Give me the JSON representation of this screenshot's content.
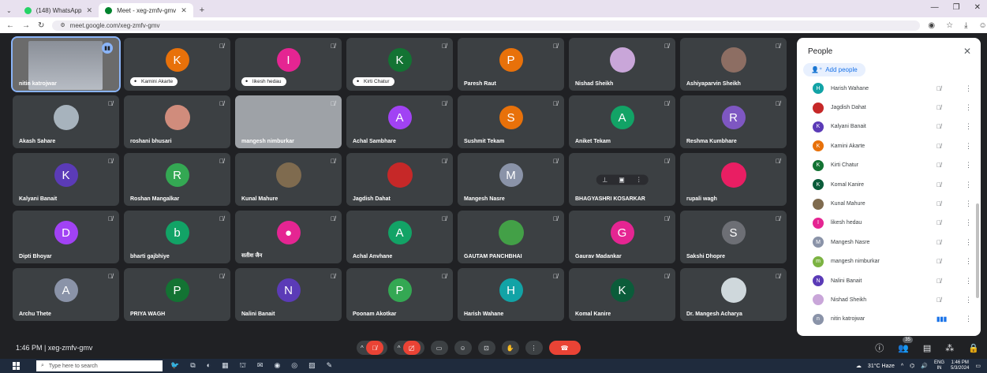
{
  "browser": {
    "tabs": [
      {
        "label": "(148) WhatsApp",
        "active": false,
        "favicon_color": "#25D366"
      },
      {
        "label": "Meet - xeg-zmfv-gmv",
        "active": true,
        "favicon_color": "#00832d"
      }
    ],
    "url": "meet.google.com/xeg-zmfv-gmv"
  },
  "tiles": [
    {
      "name": "nitin katrojwar",
      "type": "video",
      "active": true,
      "speaking": true
    },
    {
      "name": "Kamini Akarte",
      "type": "avatar",
      "letter": "K",
      "color": "#e8710a",
      "chip": true
    },
    {
      "name": "likesh hedau",
      "type": "avatar",
      "letter": "I",
      "color": "#e52592",
      "chip": true
    },
    {
      "name": "Kirti Chatur",
      "type": "avatar",
      "letter": "K",
      "color": "#137333",
      "chip": true
    },
    {
      "name": "Paresh Raut",
      "type": "avatar",
      "letter": "P",
      "color": "#e8710a"
    },
    {
      "name": "Nishad Sheikh",
      "type": "photo",
      "color": "#c9a6d9"
    },
    {
      "name": "Ashiyaparvin Sheikh",
      "type": "photo",
      "color": "#8d6e63"
    },
    {
      "name": "Akash Sahare",
      "type": "photo",
      "color": "#a7b3bd"
    },
    {
      "name": "roshani bhusari",
      "type": "photo",
      "color": "#d08c7c"
    },
    {
      "name": "mangesh nimburkar",
      "type": "greyvideo"
    },
    {
      "name": "Achal Sambhare",
      "type": "avatar",
      "letter": "A",
      "color": "#a142f4"
    },
    {
      "name": "Sushmit Tekam",
      "type": "avatar",
      "letter": "S",
      "color": "#e8710a"
    },
    {
      "name": "Aniket Tekam",
      "type": "avatar",
      "letter": "A",
      "color": "#12a366"
    },
    {
      "name": "Reshma Kumbhare",
      "type": "avatar",
      "letter": "R",
      "color": "#7e57c2"
    },
    {
      "name": "Kalyani Banait",
      "type": "avatar",
      "letter": "K",
      "color": "#5b3bb7"
    },
    {
      "name": "Roshan Mangalkar",
      "type": "avatar",
      "letter": "R",
      "color": "#34a853"
    },
    {
      "name": "Kunal Mahure",
      "type": "photo",
      "color": "#7f6b4f"
    },
    {
      "name": "Jagdish Dahat",
      "type": "photo",
      "color": "#c62828"
    },
    {
      "name": "Mangesh Nasre",
      "type": "avatar",
      "letter": "M",
      "color": "#8a93a8"
    },
    {
      "name": "BHAGYASHRI KOSARKAR",
      "type": "hover"
    },
    {
      "name": "rupali wagh",
      "type": "photo",
      "color": "#e91e63"
    },
    {
      "name": "Dipti Bhoyar",
      "type": "avatar",
      "letter": "D",
      "color": "#a142f4"
    },
    {
      "name": "bharti gajbhiye",
      "type": "avatar",
      "letter": "b",
      "color": "#12a366"
    },
    {
      "name": "सतीश जैन",
      "type": "avatar",
      "letter": "●",
      "color": "#e52592"
    },
    {
      "name": "Achal Anvhane",
      "type": "avatar",
      "letter": "A",
      "color": "#12a366"
    },
    {
      "name": "GAUTAM PANCHBHAI",
      "type": "photo",
      "color": "#43a047"
    },
    {
      "name": "Gaurav Madankar",
      "type": "avatar",
      "letter": "G",
      "color": "#e52592"
    },
    {
      "name": "Sakshi Dhopre",
      "type": "avatar",
      "letter": "S",
      "color": "#6d6f75"
    },
    {
      "name": "Archu Thete",
      "type": "avatar",
      "letter": "A",
      "color": "#8a93a8"
    },
    {
      "name": "PRIYA WAGH",
      "type": "avatar",
      "letter": "P",
      "color": "#137333"
    },
    {
      "name": "Nalini Banait",
      "type": "avatar",
      "letter": "N",
      "color": "#5b3bb7"
    },
    {
      "name": "Poonam Akotkar",
      "type": "avatar",
      "letter": "P",
      "color": "#34a853"
    },
    {
      "name": "Harish Wahane",
      "type": "avatar",
      "letter": "H",
      "color": "#12a3a6"
    },
    {
      "name": "Komal Kanire",
      "type": "avatar",
      "letter": "K",
      "color": "#0b5c3a"
    },
    {
      "name": "Dr. Mangesh Acharya",
      "type": "photo",
      "color": "#cfd8dc"
    }
  ],
  "hover_tools": [
    "pin-icon",
    "frame-icon",
    "more-icon"
  ],
  "people_panel": {
    "title": "People",
    "add_people": "Add people",
    "list": [
      {
        "name": "Harish Wahane",
        "letter": "H",
        "color": "#12a3a6",
        "mic": "muted"
      },
      {
        "name": "Jagdish Dahat",
        "letter": "",
        "color": "#c62828",
        "mic": "muted"
      },
      {
        "name": "Kalyani Banait",
        "letter": "K",
        "color": "#5b3bb7",
        "mic": "muted"
      },
      {
        "name": "Kamini Akarte",
        "letter": "K",
        "color": "#e8710a",
        "mic": "muted"
      },
      {
        "name": "Kirti Chatur",
        "letter": "K",
        "color": "#137333",
        "mic": "muted"
      },
      {
        "name": "Komal Kanire",
        "letter": "K",
        "color": "#0b5c3a",
        "mic": "muted"
      },
      {
        "name": "Kunal Mahure",
        "letter": "",
        "color": "#7f6b4f",
        "mic": "muted"
      },
      {
        "name": "likesh hedau",
        "letter": "I",
        "color": "#e52592",
        "mic": "muted"
      },
      {
        "name": "Mangesh Nasre",
        "letter": "M",
        "color": "#8a93a8",
        "mic": "muted"
      },
      {
        "name": "mangesh nimburkar",
        "letter": "m",
        "color": "#7cb342",
        "mic": "muted"
      },
      {
        "name": "Nalini Banait",
        "letter": "N",
        "color": "#5b3bb7",
        "mic": "muted"
      },
      {
        "name": "Nishad Sheikh",
        "letter": "",
        "color": "#c9a6d9",
        "mic": "muted"
      },
      {
        "name": "nitin katrojwar",
        "letter": "n",
        "color": "#8a93a8",
        "mic": "live"
      }
    ]
  },
  "meeting": {
    "time": "1:46 PM",
    "separator": "|",
    "code": "xeg-zmfv-gmv",
    "participant_count": "35"
  },
  "taskbar": {
    "search_placeholder": "Type here to search",
    "weather": "31°C Haze",
    "lang_top": "ENG",
    "lang_bottom": "IN",
    "time": "1:46 PM",
    "date": "5/3/2024"
  }
}
